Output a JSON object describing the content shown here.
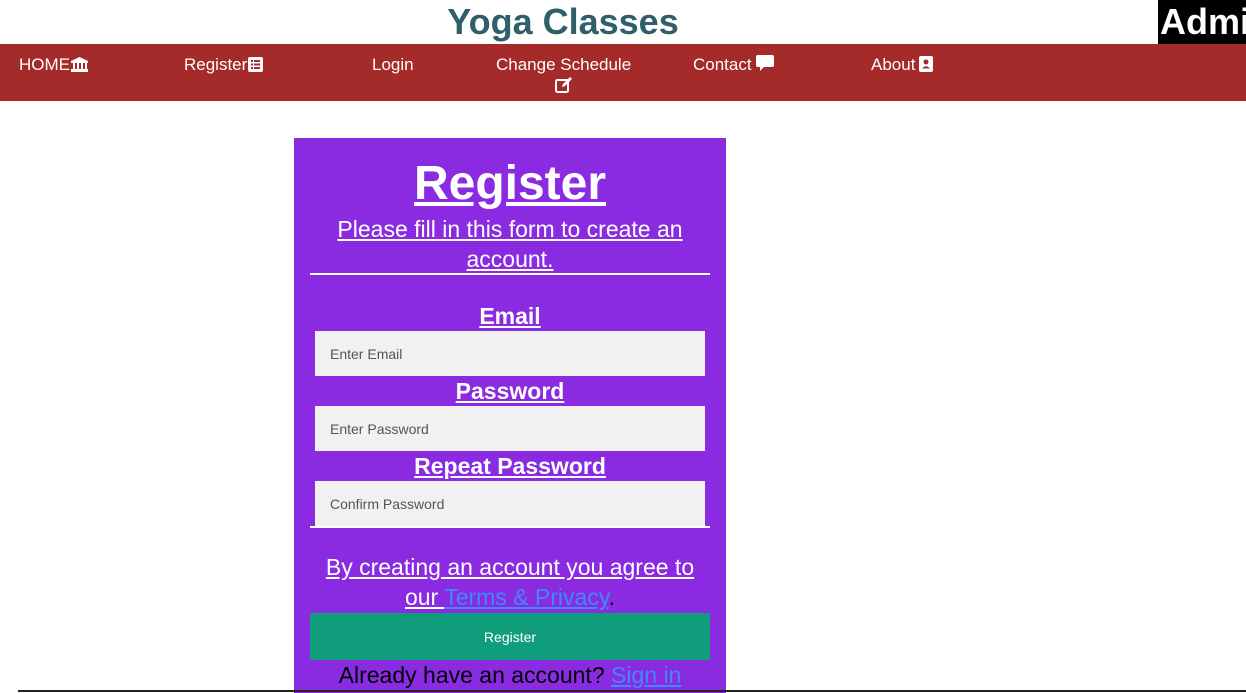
{
  "header": {
    "site_title": "Yoga Classes",
    "admin_label": "Admi"
  },
  "nav": {
    "items": [
      {
        "label": "HOME",
        "icon": "bank-icon"
      },
      {
        "label": "Register",
        "icon": "list-icon"
      },
      {
        "label": "Login",
        "icon": ""
      },
      {
        "label": "Change Schedule",
        "icon": "edit-icon"
      },
      {
        "label": "Contact",
        "icon": "comment-icon"
      },
      {
        "label": "About",
        "icon": "contact-card-icon"
      }
    ]
  },
  "form": {
    "title": "Register",
    "subtitle": "Please fill in this form to create an account.",
    "email_label": "Email",
    "email_placeholder": "Enter Email",
    "password_label": "Password",
    "password_placeholder": "Enter Password",
    "repeat_label": "Repeat Password",
    "repeat_placeholder": "Confirm Password",
    "terms_text": "By creating an account you agree to our ",
    "terms_link": "Terms & Privacy",
    "terms_end": ".",
    "register_button": "Register",
    "signin_text": "Already have an account? ",
    "signin_link": "Sign in"
  },
  "colors": {
    "navbar": "#a52a2a",
    "card": "#8a2be2",
    "button": "#109d7c",
    "link": "#3b8cf5",
    "title": "#2f5f6a"
  }
}
